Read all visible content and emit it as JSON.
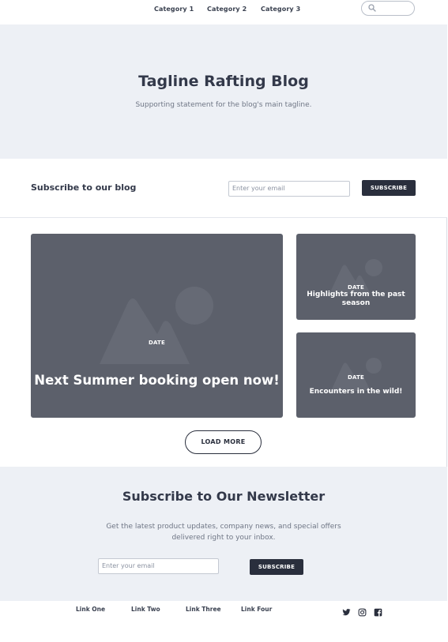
{
  "nav": {
    "links": [
      "Category 1",
      "Category 2",
      "Category 3"
    ],
    "search_icon": "search-icon"
  },
  "hero": {
    "title": "Tagline Rafting Blog",
    "subtitle": "Supporting statement for the blog's main tagline."
  },
  "subscribe_bar": {
    "title": "Subscribe to our blog",
    "email_placeholder": "Enter your email",
    "button_label": "SUBSCRIBE"
  },
  "posts": [
    {
      "date": "DATE",
      "title": "Next Summer booking open now!"
    },
    {
      "date": "DATE",
      "title": "Highlights from the past season"
    },
    {
      "date": "DATE",
      "title": "Encounters in the wild!"
    }
  ],
  "load_more_label": "LOAD MORE",
  "newsletter": {
    "title": "Subscribe to Our Newsletter",
    "text_line1": "Get the latest product updates, company news, and special offers",
    "text_line2": "delivered right to your inbox.",
    "email_placeholder": "Enter your email",
    "button_label": "SUBSCRIBE"
  },
  "footer": {
    "links": [
      "Link One",
      "Link Two",
      "Link Three",
      "Link Four"
    ],
    "social_icons": [
      "twitter-icon",
      "instagram-icon",
      "facebook-icon"
    ]
  },
  "colors": {
    "dark": "#2a2f3d",
    "card_bg": "#5c606b",
    "section_bg": "#edf0f5"
  }
}
